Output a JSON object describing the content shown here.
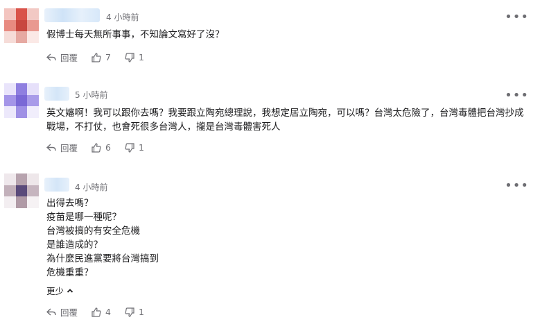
{
  "comments": [
    {
      "time": "4 小時前",
      "text": "假博士每天無所事事，不知論文寫好了沒？",
      "reply_label": "回覆",
      "likes": "7",
      "dislikes": "1"
    },
    {
      "time": "5 小時前",
      "text": "英文嬸啊！我可以跟你去嗎？我要跟立陶宛總理說，我想定居立陶宛，可以嗎？台灣太危險了，台灣毒體把台灣抄成戰場，不打仗，也會死很多台灣人，攏是台灣毒體害死人",
      "reply_label": "回覆",
      "likes": "6",
      "dislikes": "1"
    },
    {
      "time": "4 小時前",
      "text": "出得去嗎？\n疫苗是哪一種呢？\n台灣被搞的有安全危機\n是誰造成的？\n為什麼民進黨要將台灣搞到\n危機重重？",
      "show_less": "更少",
      "reply_label": "回覆",
      "likes": "4",
      "dislikes": "1"
    }
  ],
  "icons": {
    "reply": "reply-icon",
    "like": "thumbs-up-icon",
    "dislike": "thumbs-down-icon",
    "more": "more-horizontal-icon",
    "chevron": "chevron-up-icon"
  }
}
